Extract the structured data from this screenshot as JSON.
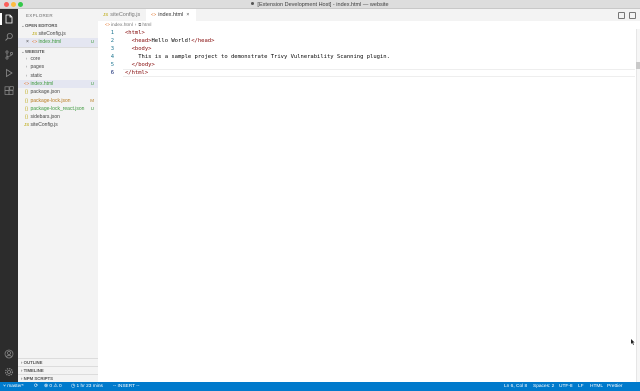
{
  "window": {
    "title": "[Extension Development Host] - index.html — website"
  },
  "activity": {
    "icons": [
      "files-icon",
      "search-icon",
      "source-control-icon",
      "debug-icon",
      "extensions-icon",
      "account-icon",
      "settings-icon"
    ]
  },
  "sidebar": {
    "title": "EXPLORER",
    "open_editors": {
      "header": "OPEN EDITORS",
      "items": [
        {
          "name": "siteConfig.js",
          "mark": ""
        },
        {
          "name": "index.html",
          "mark": "U",
          "close": "×"
        }
      ]
    },
    "website": {
      "header": "WEBSITE",
      "items": [
        {
          "name": "core",
          "folder": true
        },
        {
          "name": "pages",
          "folder": true
        },
        {
          "name": "static",
          "folder": true
        },
        {
          "name": "index.html",
          "mark": "U"
        },
        {
          "name": "package.json",
          "mark": ""
        },
        {
          "name": "package-lock.json",
          "mark": "M"
        },
        {
          "name": "package-lock_react.json",
          "mark": "U"
        },
        {
          "name": "sidebars.json",
          "mark": ""
        },
        {
          "name": "siteConfig.js",
          "mark": ""
        }
      ]
    },
    "bottom_sections": [
      "OUTLINE",
      "TIMELINE",
      "NPM SCRIPTS"
    ]
  },
  "tabs": [
    {
      "label": "siteConfig.js",
      "icon": "JS"
    },
    {
      "label": "index.html",
      "icon": "<>",
      "close": "×"
    }
  ],
  "breadcrumb": {
    "file": "index.html",
    "node": "html",
    "sep": "›"
  },
  "editor": {
    "lines": [
      {
        "n": "1",
        "indent": "",
        "parts": [
          [
            "tag",
            "<html>"
          ]
        ]
      },
      {
        "n": "2",
        "indent": "  ",
        "parts": [
          [
            "tag",
            "<head>"
          ],
          [
            "txt",
            "Hello World!"
          ],
          [
            "tag",
            "</head>"
          ]
        ]
      },
      {
        "n": "3",
        "indent": "  ",
        "parts": [
          [
            "tag",
            "<body>"
          ]
        ]
      },
      {
        "n": "4",
        "indent": "    ",
        "parts": [
          [
            "txt",
            "This is a sample project to demonstrate Trivy Vulnerability Scanning plugin."
          ]
        ]
      },
      {
        "n": "5",
        "indent": "  ",
        "parts": [
          [
            "tag",
            "</body>"
          ]
        ]
      },
      {
        "n": "6",
        "indent": "",
        "parts": [
          [
            "tag",
            "</html>"
          ]
        ]
      }
    ]
  },
  "status": {
    "branch": "master*",
    "sync": "⟳",
    "problems": "⊗ 0 ⚠ 0",
    "time": "1 hr 23 mins",
    "mode": "-- INSERT --",
    "position": "Ln 6, Col 8",
    "spaces": "Spaces: 2",
    "encoding": "UTF-8",
    "eol": "LF",
    "language": "HTML",
    "formatter": "Prettier"
  }
}
